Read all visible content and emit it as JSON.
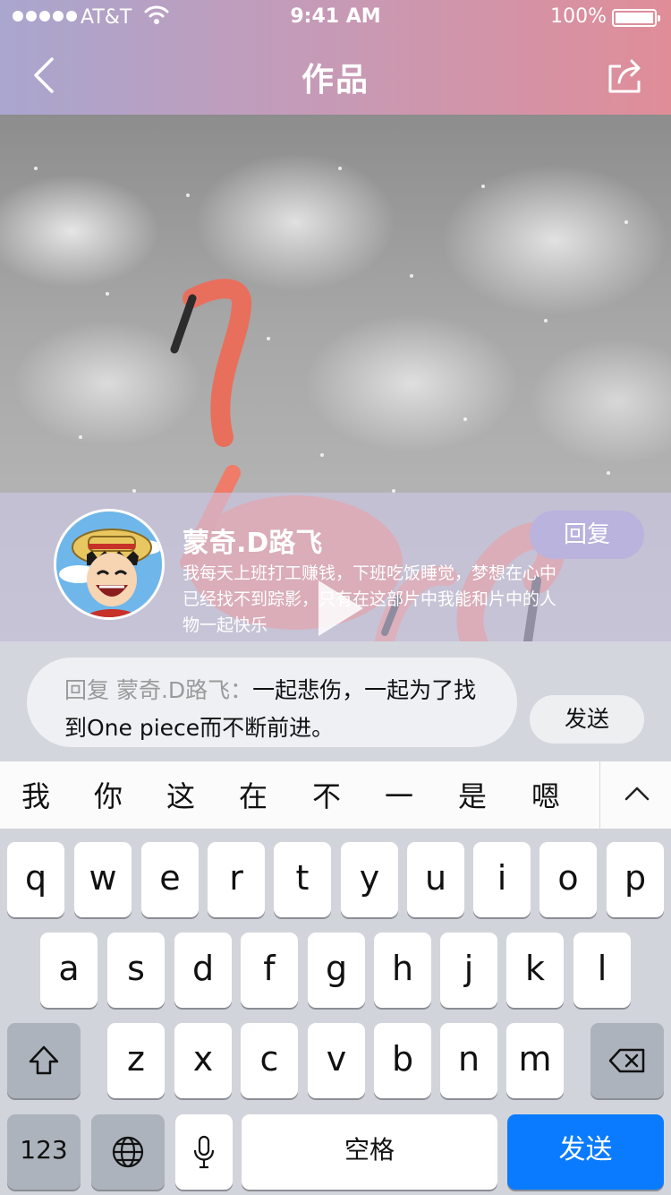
{
  "status_bar": {
    "carrier": "AT&T",
    "time": "9:41 AM",
    "battery": "100%"
  },
  "nav": {
    "title": "作品"
  },
  "post": {
    "username": "蒙奇.D路飞",
    "bio": "我每天上班打工赚钱，下班吃饭睡觉，梦想在心中已经找不到踪影，只有在这部片中我能和片中的人物一起快乐",
    "reply_label": "回复"
  },
  "composer": {
    "reply_prefix": "回复  蒙奇.D路飞：",
    "text": "一起悲伤，一起为了找到One piece而不断前进。",
    "send_label": "发送"
  },
  "candidates": [
    "我",
    "你",
    "这",
    "在",
    "不",
    "一",
    "是",
    "嗯"
  ],
  "keyboard": {
    "row1": [
      "q",
      "w",
      "e",
      "r",
      "t",
      "y",
      "u",
      "i",
      "o",
      "p"
    ],
    "row2": [
      "a",
      "s",
      "d",
      "f",
      "g",
      "h",
      "j",
      "k",
      "l"
    ],
    "row3": [
      "z",
      "x",
      "c",
      "v",
      "b",
      "n",
      "m"
    ],
    "numbers_label": "123",
    "space_label": "空格",
    "return_label": "发送"
  },
  "colors": {
    "nav_gradient_start": "#a9a6cf",
    "nav_gradient_end": "#e08d98",
    "reply_button": "#b9b3de",
    "return_key": "#0a7bff"
  },
  "icons": {
    "back": "chevron-left-icon",
    "share": "share-icon",
    "play": "play-icon",
    "shift": "shift-icon",
    "delete": "backspace-icon",
    "globe": "globe-icon",
    "mic": "microphone-icon",
    "collapse": "chevron-up-icon"
  }
}
